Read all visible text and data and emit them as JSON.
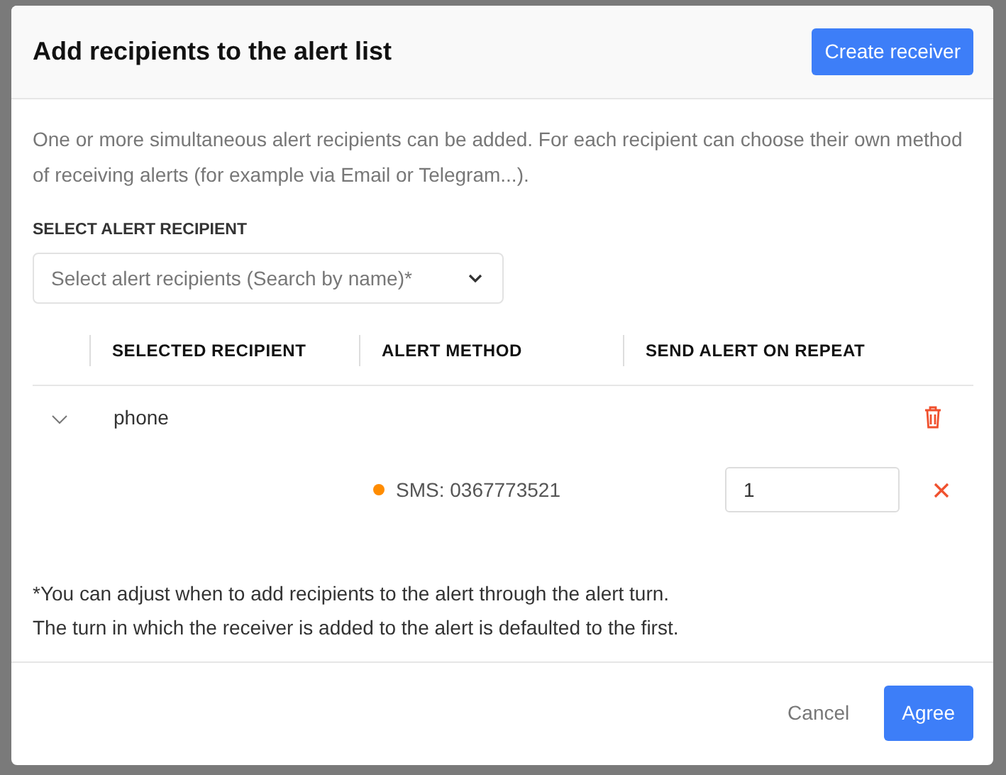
{
  "dialog": {
    "title": "Add recipients to the alert list",
    "create_button": "Create receiver"
  },
  "description": "One or more simultaneous alert recipients can be added. For each recipient can choose their own method of receiving alerts (for example via Email or Telegram...).",
  "select": {
    "label": "SELECT ALERT RECIPIENT",
    "placeholder": "Select alert recipients (Search by name)*"
  },
  "table": {
    "columns": [
      "SELECTED RECIPIENT",
      "ALERT METHOD",
      "SEND ALERT ON REPEAT"
    ],
    "rows": [
      {
        "name": "phone",
        "expanded": true,
        "methods": [
          {
            "label": "SMS: 0367773521",
            "color": "#ff8c00",
            "repeat": "1"
          }
        ]
      }
    ]
  },
  "notes": [
    "*You can adjust when to add recipients to the alert through the alert turn.",
    "The turn in which the receiver is added to the alert is defaulted to the first."
  ],
  "footer": {
    "cancel": "Cancel",
    "agree": "Agree"
  }
}
